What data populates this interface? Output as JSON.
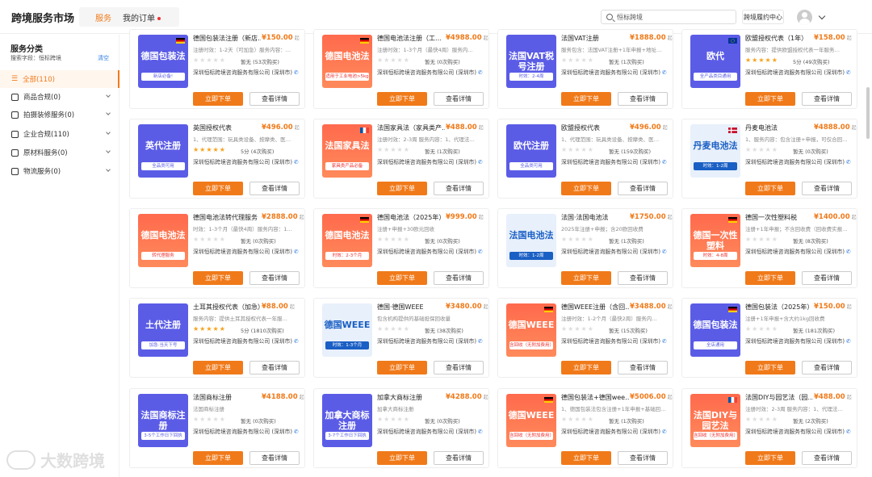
{
  "header": {
    "brand": "跨境服务市场",
    "tabs": [
      {
        "label": "服务"
      },
      {
        "label": "我的订单"
      }
    ],
    "search_value": "恒标跨境",
    "perf_center": "跨境履约中心"
  },
  "sidebar": {
    "title": "服务分类",
    "subtitle": "搜索字段：恒标跨境",
    "clear": "清空",
    "items": [
      {
        "label": "全部(110)"
      },
      {
        "label": "商品合规(0)"
      },
      {
        "label": "拍摄装修服务(0)"
      },
      {
        "label": "企业合规(110)"
      },
      {
        "label": "原材料服务(0)"
      },
      {
        "label": "物流服务(0)"
      }
    ]
  },
  "common": {
    "buy": "立即下单",
    "detail": "查看详情",
    "unit": "起"
  },
  "cards": [
    {
      "thumb_color": "blue",
      "thumb_title": "德国包装法",
      "thumb_sub": "新店必备!",
      "flag": "de",
      "title": "德国包装法注册（新店…",
      "price": "¥150.00",
      "desc": "注册时效：1-2天（可加急）服务内容：…",
      "score": "暂无 (53次购买)",
      "rating": 0,
      "company": "深圳恒标跨境咨询服务有限公司 (深圳市)"
    },
    {
      "thumb_color": "red",
      "thumb_title": "德国电池法",
      "thumb_sub": "适用于工业电池>5kg",
      "flag": "de",
      "title": "德国电池法注册（工…",
      "price": "¥4988.00",
      "desc": "注册时效：1-3个月（最快4周）服务内…",
      "score": "暂无 (0次购买)",
      "rating": 0,
      "company": "深圳恒标跨境咨询服务有限公司 (深圳市)"
    },
    {
      "thumb_color": "blue",
      "thumb_title": "法国VAT税号注册",
      "thumb_sub": "时效：2-4周",
      "flag": "",
      "title": "法国VAT注册",
      "price": "¥1888.00",
      "desc": "服务包含：法国VAT注册+1年申报+地址…",
      "score": "暂无 (1次购买)",
      "rating": 0,
      "company": "深圳恒标跨境咨询服务有限公司 (深圳市)"
    },
    {
      "thumb_color": "blue",
      "thumb_title": "欧代",
      "thumb_sub": "全产品类目通用",
      "flag": "eu",
      "title": "欧盟授权代表（1年）",
      "price": "¥158.00",
      "desc": "服务内容：提供欧盟授权代表一年服务…",
      "score": "5分 (49次购买)",
      "rating": 5,
      "company": "深圳恒标跨境咨询服务有限公司 (深圳市)"
    },
    {
      "thumb_color": "blue",
      "thumb_title": "英代注册",
      "thumb_sub": "全品类可用",
      "flag": "",
      "title": "英国授权代表",
      "price": "¥496.00",
      "desc": "1、代理范围：玩具类设备、按摩类、医…",
      "score": "5分 (4次购买)",
      "rating": 5,
      "company": "深圳恒标跨境咨询服务有限公司 (深圳市)"
    },
    {
      "thumb_color": "red",
      "thumb_title": "法国家具法",
      "thumb_sub": "家具类产品必备",
      "flag": "fr",
      "title": "法国家具法（家具类产…",
      "price": "¥488.00",
      "desc": "注册时效：2-3周 服务内容：1、代理法…",
      "score": "暂无 (1次购买)",
      "rating": 0,
      "company": "深圳恒标跨境咨询服务有限公司 (深圳市)"
    },
    {
      "thumb_color": "blue",
      "thumb_title": "欧代注册",
      "thumb_sub": "全品类可用",
      "flag": "",
      "title": "欧盟授权代表",
      "price": "¥496.00",
      "desc": "1、代理范围：玩具类设备、按摩类、医…",
      "score": "暂无 (159次购买)",
      "rating": 0,
      "company": "深圳恒标跨境咨询服务有限公司 (深圳市)"
    },
    {
      "thumb_color": "lb",
      "thumb_title": "丹麦电池法",
      "thumb_sub": "时效：1-2周",
      "flag": "dk",
      "title": "丹麦电池法",
      "price": "¥4888.00",
      "desc": "1、服务内容：包含注册+申报，可仅合回…",
      "score": "暂无 (0次购买)",
      "rating": 0,
      "company": "深圳恒标跨境咨询服务有限公司 (深圳市)"
    },
    {
      "thumb_color": "red",
      "thumb_title": "德国电池法",
      "thumb_sub": "转代理服务",
      "flag": "",
      "title": "德国电池法转代理服务",
      "price": "¥2888.00",
      "desc": "时效：1-3个月（最快4周）服务内容：1…",
      "score": "暂无 (0次购买)",
      "rating": 0,
      "company": "深圳恒标跨境咨询服务有限公司 (深圳市)"
    },
    {
      "thumb_color": "red",
      "thumb_title": "德国电池法",
      "thumb_sub": "时效：2-3个月",
      "flag": "de",
      "title": "德国电池法（2025年）",
      "price": "¥999.00",
      "desc": "注册+申报+30欧元回收",
      "score": "暂无 (0次购买)",
      "rating": 0,
      "company": "深圳恒标跨境咨询服务有限公司 (深圳市)"
    },
    {
      "thumb_color": "lb",
      "thumb_title": "法国电池法",
      "thumb_sub": "时效：1-2周",
      "flag": "",
      "title": "法国·法国电池法",
      "price": "¥1750.00",
      "desc": "2025年注册+申报；含20欧回收费",
      "score": "暂无 (1次购买)",
      "rating": 0,
      "company": "深圳恒标跨境咨询服务有限公司 (深圳市)"
    },
    {
      "thumb_color": "red",
      "thumb_title": "德国一次性塑料",
      "thumb_sub": "时效：4-8周",
      "flag": "de",
      "title": "德国一次性塑料税",
      "price": "¥1400.00",
      "desc": "注册+1年申报；不含回收费（回收费实报…",
      "score": "暂无 (8次购买)",
      "rating": 0,
      "company": "深圳恒标跨境咨询服务有限公司 (深圳市)"
    },
    {
      "thumb_color": "blue",
      "thumb_title": "土代注册",
      "thumb_sub": "加急·当天下号",
      "flag": "",
      "title": "土耳其授权代表（加急）",
      "price": "¥88.00",
      "desc": "服务内容：提供土耳其授权代表一年服…",
      "score": "5分 (1810次购买)",
      "rating": 5,
      "company": "深圳恒标跨境咨询服务有限公司 (深圳市)"
    },
    {
      "thumb_color": "lb",
      "thumb_title": "德国WEEE",
      "thumb_sub": "时效：1-3个月",
      "flag": "",
      "title": "德国·德国WEEE",
      "price": "¥3480.00",
      "desc": "包含机构提供的基础担保回收量",
      "score": "暂无 (38次购买)",
      "rating": 0,
      "company": "深圳恒标跨境咨询服务有限公司 (深圳市)"
    },
    {
      "thumb_color": "red",
      "thumb_title": "德国WEEE",
      "thumb_sub": "含回收（无附加费用）",
      "flag": "de",
      "title": "德国WEEE注册（含回…",
      "price": "¥3488.00",
      "desc": "注册时效：1-2个月（最快2周）服务内…",
      "score": "暂无 (15次购买)",
      "rating": 0,
      "company": "深圳恒标跨境咨询服务有限公司 (深圳市)"
    },
    {
      "thumb_color": "blue",
      "thumb_title": "德国包装法",
      "thumb_sub": "全店通用",
      "flag": "de",
      "title": "德国包装法（2025年）",
      "price": "¥150.00",
      "desc": "注册+1年申报+含大约1kg回收费",
      "score": "暂无 (181次购买)",
      "rating": 0,
      "company": "深圳恒标跨境咨询服务有限公司 (深圳市)"
    },
    {
      "thumb_color": "blue",
      "thumb_title": "法国商标注册",
      "thumb_sub": "3-5个工作日下回执",
      "flag": "",
      "title": "法国商标注册",
      "price": "¥4188.00",
      "desc": "法国商标注册",
      "score": "暂无 (0次购买)",
      "rating": 0,
      "company": "深圳恒标跨境咨询服务有限公司 (深圳市)"
    },
    {
      "thumb_color": "blue",
      "thumb_title": "加拿大商标注册",
      "thumb_sub": "3-7个工作日下回执",
      "flag": "",
      "title": "加拿大商标注册",
      "price": "¥4288.00",
      "desc": "加拿大商标注册",
      "score": "暂无 (0次购买)",
      "rating": 0,
      "company": "深圳恒标跨境咨询服务有限公司 (深圳市)"
    },
    {
      "thumb_color": "red",
      "thumb_title": "德国WEEE",
      "thumb_sub": "含回收（无附加费用）",
      "flag": "de",
      "title": "德国包装法+德国wee…",
      "price": "¥5006.00",
      "desc": "1、德国包装法包含注册+1年申报+基础回…",
      "score": "暂无 (1次购买)",
      "rating": 0,
      "company": "深圳恒标跨境咨询服务有限公司 (深圳市)"
    },
    {
      "thumb_color": "red",
      "thumb_title": "法国DIY与园艺法",
      "thumb_sub": "含回收（无附加费用）",
      "flag": "fr",
      "title": "法国DIY与园艺法（园…",
      "price": "¥488.00",
      "desc": "注册时效：2-3周 服务内容：1、代理法…",
      "score": "暂无 (2次购买)",
      "rating": 0,
      "company": "深圳恒标跨境咨询服务有限公司 (深圳市)"
    }
  ],
  "watermark": "大数跨境"
}
